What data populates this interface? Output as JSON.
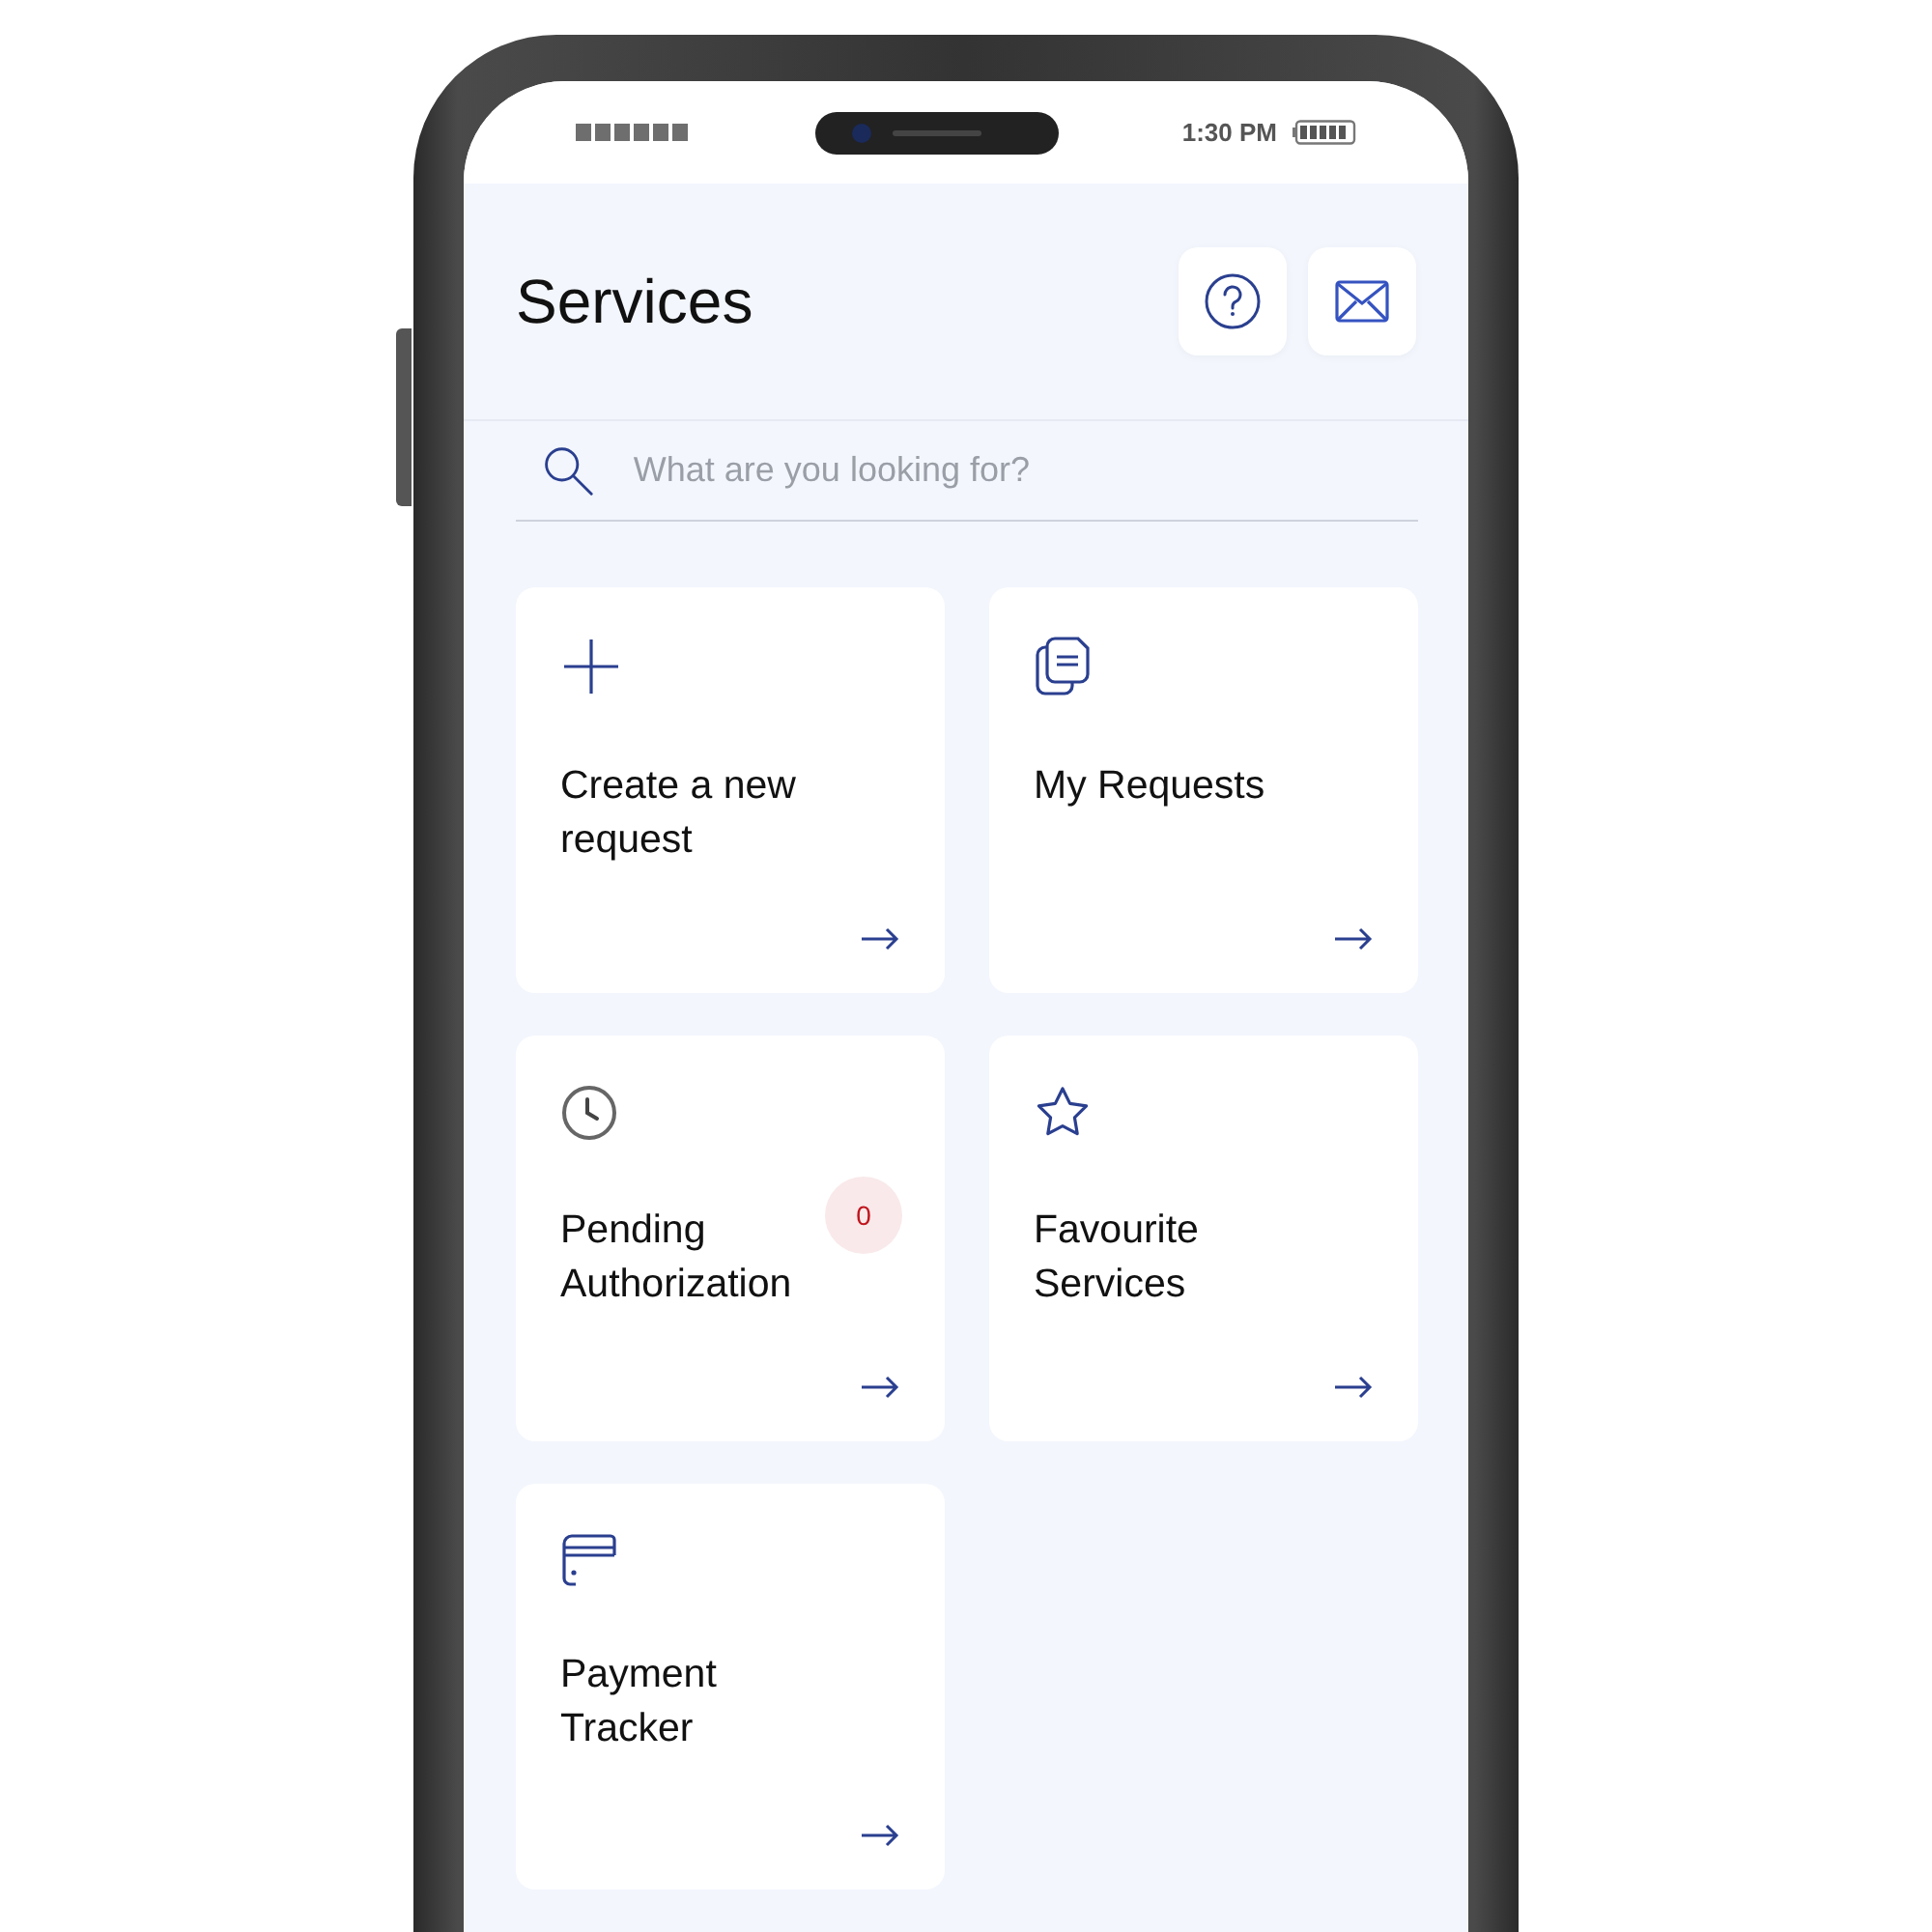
{
  "status_bar": {
    "time": "1:30 PM"
  },
  "header": {
    "title": "Services"
  },
  "search": {
    "placeholder": "What are you looking for?"
  },
  "cards": [
    {
      "title": "Create a new request"
    },
    {
      "title": "My Requests"
    },
    {
      "title": "Pending Authorization",
      "badge": "0"
    },
    {
      "title": "Favourite Services"
    },
    {
      "title": "Payment Tracker"
    }
  ]
}
